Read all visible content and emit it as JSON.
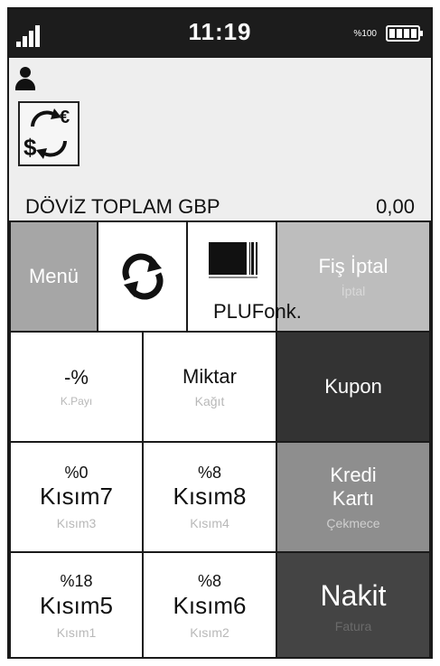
{
  "status_bar": {
    "time": "11:19",
    "battery_percent": "%100",
    "signal_icon": "signal-bars-icon",
    "battery_icon": "battery-full-icon"
  },
  "info": {
    "user_icon": "user-icon",
    "currency_icon": "currency-exchange-icon",
    "doviz_label": "DÖVİZ TOPLAM GBP",
    "doviz_value": "0,00"
  },
  "keys": {
    "menu": {
      "label": "Menü"
    },
    "refresh": {
      "icon": "refresh-icon"
    },
    "plu": {
      "icon": "barcode-icon",
      "label": "PLUFonk."
    },
    "fis_iptal": {
      "label": "Fiş İptal",
      "sub": "İptal"
    },
    "percent": {
      "label": "-%",
      "sub": "K.Payı"
    },
    "miktar": {
      "label": "Miktar",
      "sub": "Kağıt"
    },
    "kupon": {
      "label": "Kupon"
    },
    "kisim7": {
      "top": "%0",
      "label": "Kısım7",
      "sub": "Kısım3"
    },
    "kisim8": {
      "top": "%8",
      "label": "Kısım8",
      "sub": "Kısım4"
    },
    "kredi": {
      "label1": "Kredi",
      "label2": "Kartı",
      "sub": "Çekmece"
    },
    "kisim5": {
      "top": "%18",
      "label": "Kısım5",
      "sub": "Kısım1"
    },
    "kisim6": {
      "top": "%8",
      "label": "Kısım6",
      "sub": "Kısım2"
    },
    "nakit": {
      "label": "Nakit",
      "sub": "Fatura"
    }
  },
  "colors": {
    "status_bar": "#1c1c1c",
    "info_bg": "#eeeeee",
    "menu_key": "#a6a6a6",
    "fis_iptal_key": "#bdbdbd",
    "kupon_key": "#333333",
    "kredi_key": "#8e8e8e",
    "nakit_key": "#444444"
  }
}
